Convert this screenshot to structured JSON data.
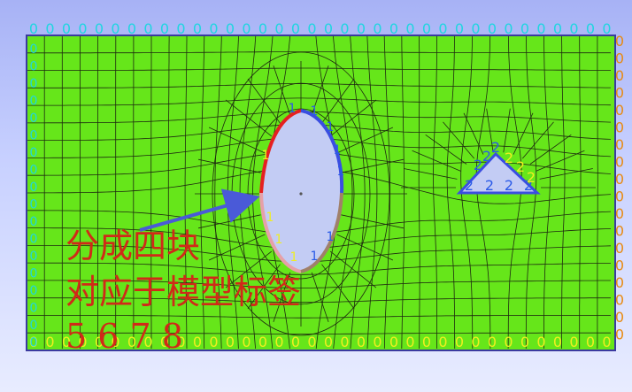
{
  "annotation": {
    "line1": "分成四块",
    "line2": "对应于模型标签",
    "line3": "5 6 7 8"
  },
  "labels": {
    "boundary_left": "0",
    "boundary_right": "0",
    "boundary_top": "0",
    "boundary_bottom": "0",
    "ellipse_left": "1",
    "ellipse_right": "1",
    "triangle": "2"
  },
  "colors": {
    "mesh_fill": "#66e61a",
    "mesh_line": "#1e2a10",
    "domain_border": "#3a3aa0",
    "hole_fill": "#c3ccf4",
    "edge_red": "#e52020",
    "edge_blue": "#3a4ee0",
    "edge_pink": "#e6a0a8",
    "edge_brown": "#a0806a",
    "arrow": "#4a5ad8",
    "label_cyan": "#1fd6e0",
    "label_yellow": "#f0ee20",
    "label_orange": "#e88a10",
    "label_blue": "#2a5ae8",
    "annotation_red": "#d02a18"
  }
}
